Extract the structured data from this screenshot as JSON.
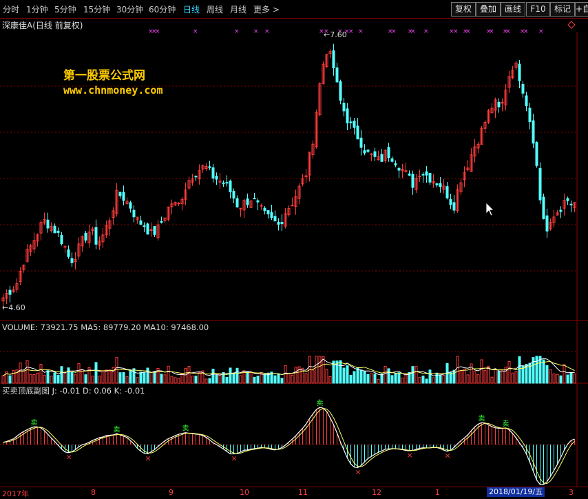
{
  "toolbar": {
    "periods": [
      "分时",
      "1分钟",
      "5分钟",
      "15分钟",
      "30分钟",
      "60分钟",
      "日线",
      "周线",
      "月线",
      "更多 >"
    ],
    "active_period": "日线",
    "right_buttons": [
      "复权",
      "叠加",
      "画线",
      "F10",
      "标记",
      "+自"
    ]
  },
  "stock": {
    "title": "深康佳A(日线 前复权)"
  },
  "watermark": {
    "line1": "第一股票公式网",
    "line2": "www.chnmoney.com"
  },
  "price_panel": {
    "high_label": "7.60",
    "low_label": "4.60",
    "marker_symbol": "×"
  },
  "volume_panel": {
    "label": "VOLUME: 73921.75  MA5: 89779.20  MA10: 97468.00"
  },
  "indicator_panel": {
    "label": "买卖顶底副图  J: -0.01  D: 0.06  K: -0.01",
    "sell_glyph": "卖",
    "buy_glyph": "×"
  },
  "date_axis": {
    "labels": [
      "2017年",
      "8",
      "9",
      "10",
      "11",
      "12",
      "1",
      "3"
    ],
    "selected": "2018/01/19/五"
  },
  "colors": {
    "up": "#ff3b3b",
    "down": "#54ffff",
    "active_period": "#36d6ff",
    "watermark": "#ffcc00",
    "marker": "#ff40ff",
    "grid": "#8b0000"
  },
  "chart_data": {
    "type": "candlestick",
    "price_range": [
      4.6,
      7.6
    ],
    "close_series": [
      4.7,
      4.78,
      4.85,
      5.1,
      5.25,
      5.4,
      5.55,
      5.5,
      5.42,
      5.3,
      5.1,
      5.2,
      5.35,
      5.45,
      5.3,
      5.4,
      5.6,
      5.85,
      5.8,
      5.7,
      5.55,
      5.5,
      5.4,
      5.45,
      5.6,
      5.75,
      5.7,
      5.9,
      6.05,
      6.1,
      6.15,
      6.05,
      6.0,
      5.95,
      5.85,
      5.7,
      5.75,
      5.8,
      5.7,
      5.6,
      5.55,
      5.5,
      5.65,
      5.75,
      5.9,
      6.05,
      6.4,
      7.0,
      7.45,
      7.3,
      6.9,
      6.7,
      6.55,
      6.45,
      6.3,
      6.25,
      6.2,
      6.3,
      6.25,
      6.15,
      6.05,
      5.95,
      6.1,
      6.05,
      6.0,
      5.95,
      5.85,
      5.7,
      6.0,
      6.15,
      6.35,
      6.5,
      6.7,
      6.85,
      6.75,
      7.1,
      7.3,
      7.1,
      6.8,
      6.4,
      5.7,
      5.4,
      5.6,
      5.7,
      5.75,
      5.7
    ]
  }
}
